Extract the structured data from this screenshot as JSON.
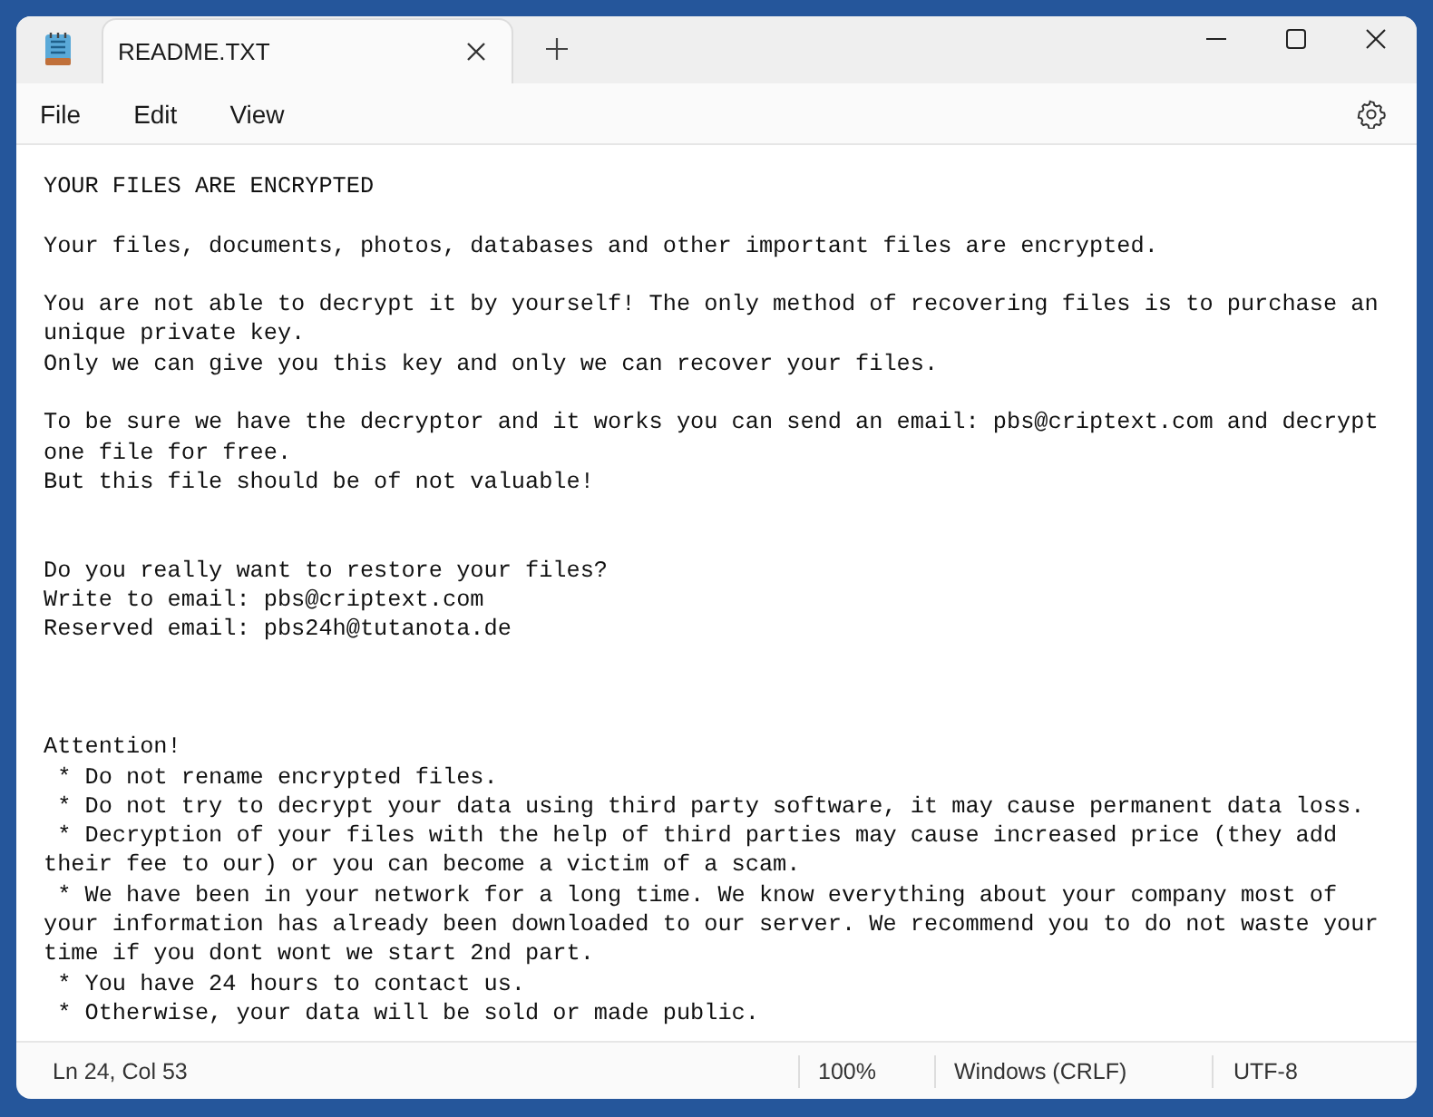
{
  "tabs": [
    {
      "title": "README.TXT",
      "selected": true
    }
  ],
  "menu": [
    "File",
    "Edit",
    "View"
  ],
  "document": {
    "text": "YOUR FILES ARE ENCRYPTED\n\nYour files, documents, photos, databases and other important files are encrypted.\n\nYou are not able to decrypt it by yourself! The only method of recovering files is to purchase an unique private key.\nOnly we can give you this key and only we can recover your files.\n\nTo be sure we have the decryptor and it works you can send an email: pbs@criptext.com and decrypt one file for free.\nBut this file should be of not valuable!\n\n\nDo you really want to restore your files?\nWrite to email: pbs@criptext.com\nReserved email: pbs24h@tutanota.de\n\n\n\nAttention!\n * Do not rename encrypted files.\n * Do not try to decrypt your data using third party software, it may cause permanent data loss.\n * Decryption of your files with the help of third parties may cause increased price (they add their fee to our) or you can become a victim of a scam.\n * We have been in your network for a long time. We know everything about your company most of your information has already been downloaded to our server. We recommend you to do not waste your time if you dont wont we start 2nd part.\n * You have 24 hours to contact us.\n * Otherwise, your data will be sold or made public."
  },
  "status_bar": {
    "position": "Ln 24, Col 53",
    "zoom": "100%",
    "line_ending": "Windows (CRLF)",
    "encoding": "UTF-8"
  }
}
